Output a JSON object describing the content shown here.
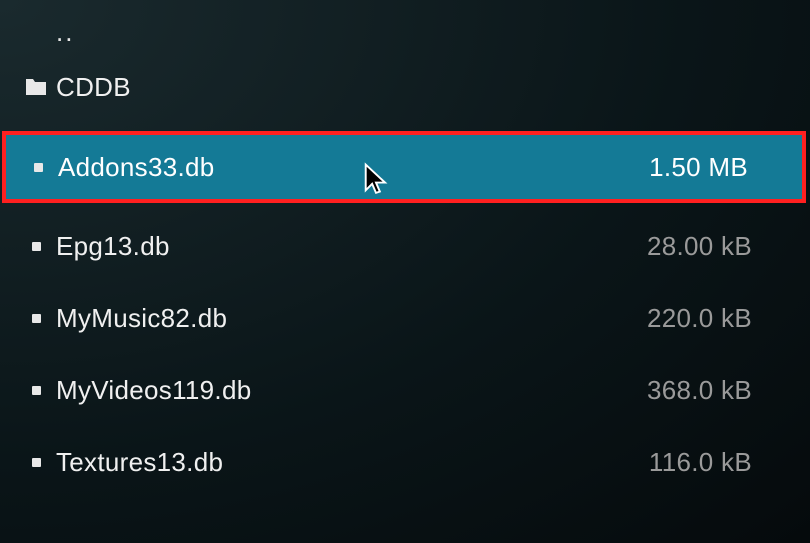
{
  "parent_label": "..",
  "items": [
    {
      "type": "folder",
      "name": "CDDB",
      "size": ""
    },
    {
      "type": "file",
      "name": "Addons33.db",
      "size": "1.50 MB",
      "highlighted": true
    },
    {
      "type": "file",
      "name": "Epg13.db",
      "size": "28.00 kB"
    },
    {
      "type": "file",
      "name": "MyMusic82.db",
      "size": "220.0 kB"
    },
    {
      "type": "file",
      "name": "MyVideos119.db",
      "size": "368.0 kB"
    },
    {
      "type": "file",
      "name": "Textures13.db",
      "size": "116.0 kB"
    }
  ]
}
